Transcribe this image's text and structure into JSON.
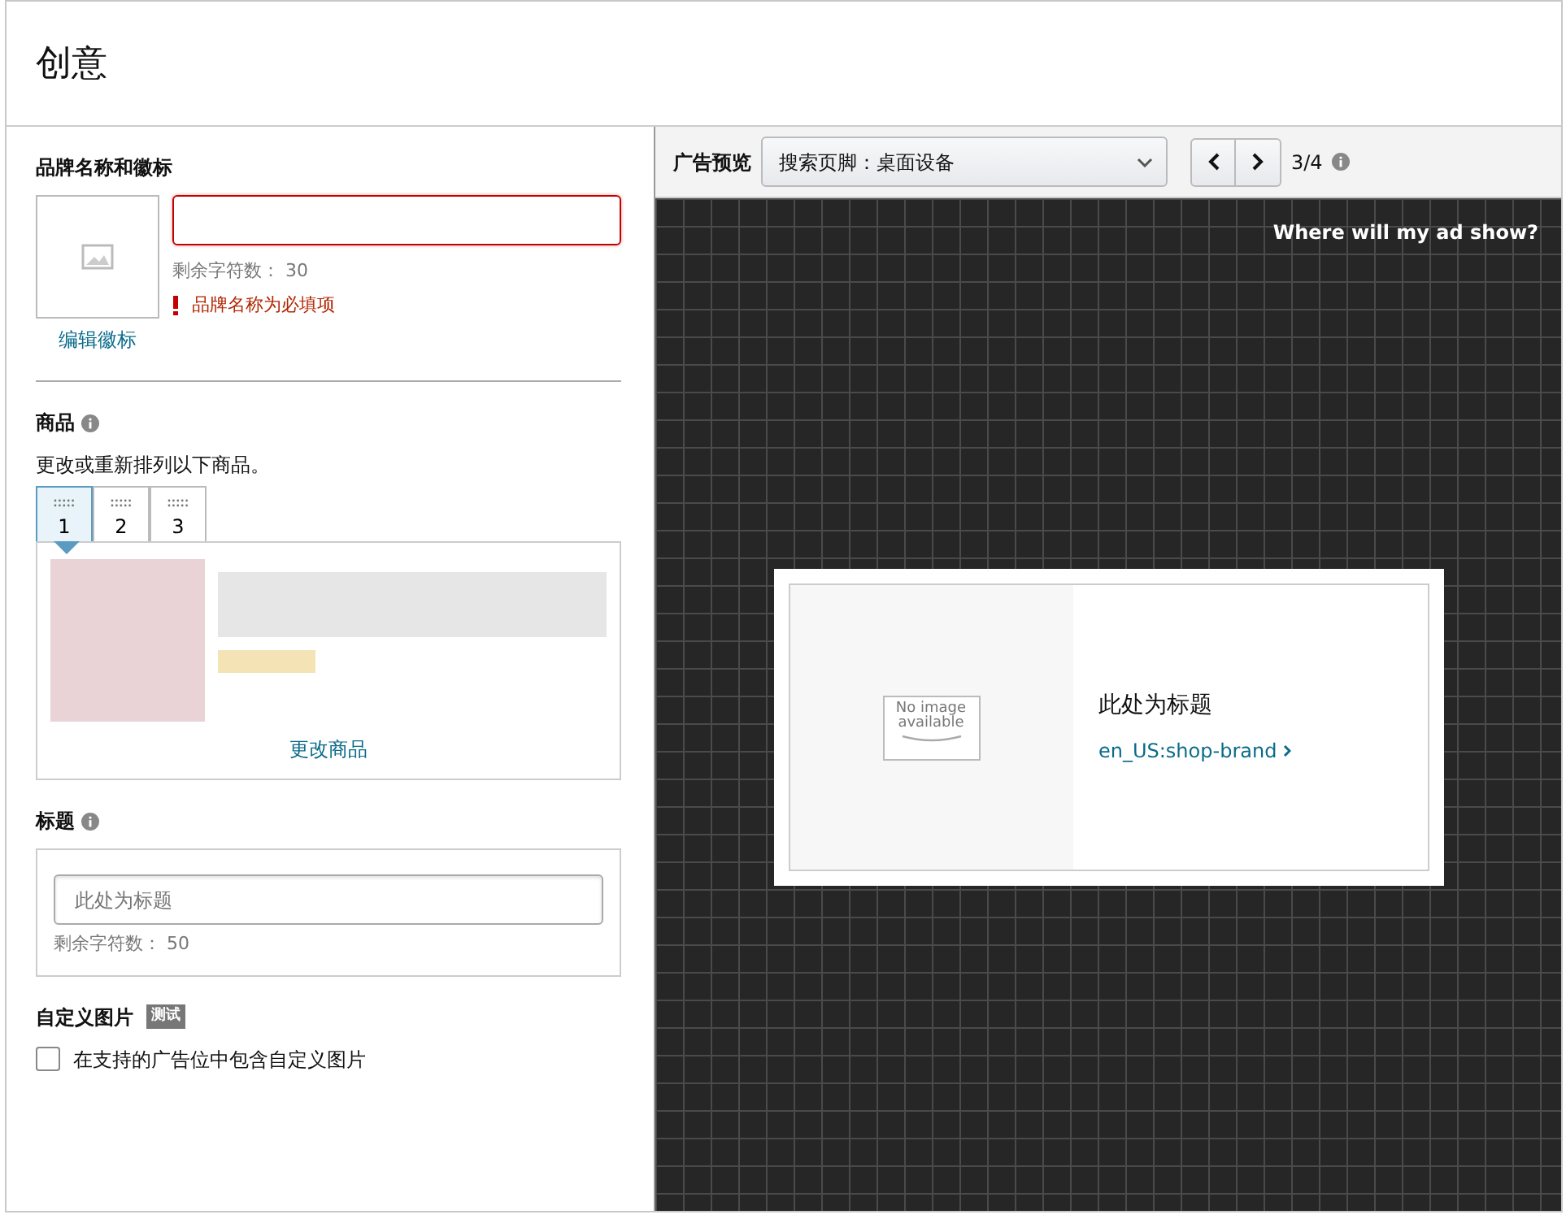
{
  "page": {
    "title": "创意"
  },
  "brand": {
    "heading": "品牌名称和徽标",
    "logo_link": "编辑徽标",
    "invalid": true,
    "remaining": "剩余字符数： 30",
    "error": "品牌名称为必填项"
  },
  "products": {
    "heading": "商品",
    "hint": "更改或重新排列以下商品。",
    "tabs": [
      {
        "label": "1",
        "selected": true
      },
      {
        "label": "2",
        "selected": false
      },
      {
        "label": "3",
        "selected": false
      }
    ],
    "change_link": "更改商品"
  },
  "headline": {
    "heading": "标题",
    "placeholder": "此处为标题",
    "remaining": "剩余字符数： 50"
  },
  "custom_image": {
    "heading": "自定义图片",
    "badge": "测试",
    "checkbox": {
      "label": "在支持的广告位中包含自定义图片",
      "checked": false
    }
  },
  "preview": {
    "label": "广告预览",
    "placement": "搜索页脚：桌面设备",
    "counter": "3/4",
    "help_link": "Where will my ad show?",
    "ad": {
      "image_text": "No image available",
      "headline": "此处为标题",
      "brand_link": "en_US:shop-brand"
    }
  }
}
